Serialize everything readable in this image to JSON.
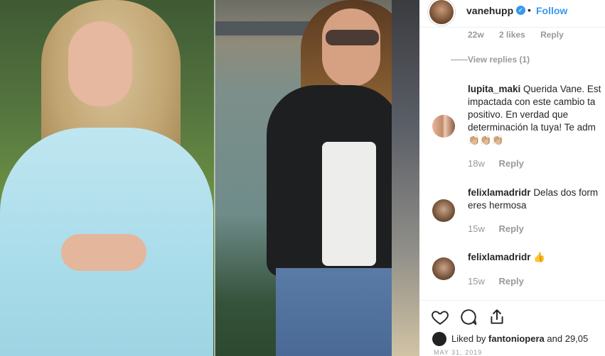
{
  "post": {
    "username": "vanehupp",
    "verified_mark": "✓",
    "separator": "•",
    "follow_label": "Follow"
  },
  "partial_comment_meta": {
    "age": "22w",
    "likes": "2 likes",
    "reply": "Reply"
  },
  "view_replies_label": "View replies (1)",
  "comments": [
    {
      "username": "lupita_maki",
      "lines": [
        "Querida Vane. Est",
        "impactada con este cambio ta",
        "positivo. En verdad que",
        "determinación la tuya! Te adm"
      ],
      "emoji": "👏🏼👏🏼👏🏼",
      "age": "18w",
      "reply": "Reply"
    },
    {
      "username": "felixlamadridr",
      "lines": [
        "Delas dos form",
        "eres hermosa"
      ],
      "age": "15w",
      "reply": "Reply"
    },
    {
      "username": "felixlamadridr",
      "lines": [
        "👍"
      ],
      "age": "15w",
      "reply": "Reply"
    }
  ],
  "actions": {
    "like": "heart-icon",
    "comment": "comment-icon",
    "share": "share-icon"
  },
  "likes_summary": {
    "prefix": "Liked by",
    "user": "fantoniopera",
    "suffix": "and 29,05"
  },
  "timestamp": "MAY 31, 2019",
  "colors": {
    "accent": "#3897f0",
    "muted": "#999999",
    "text": "#262626"
  }
}
